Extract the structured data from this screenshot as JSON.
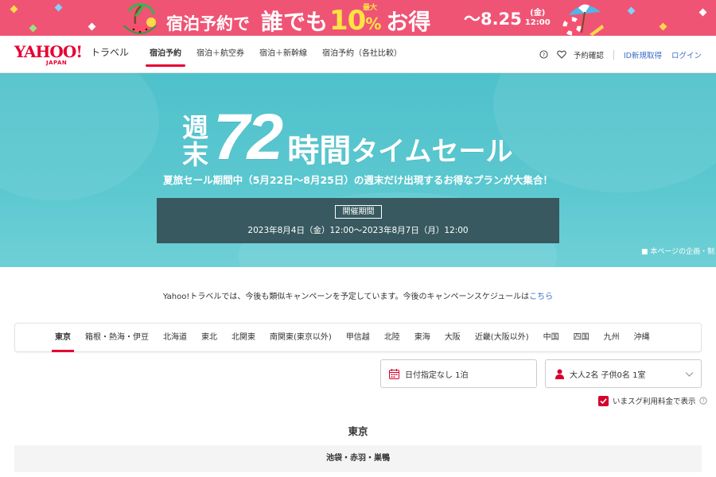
{
  "promo": {
    "text_part1": "宿泊予約で",
    "text_part2": "誰でも",
    "text_discount": "10",
    "text_percent": "%",
    "text_max": "最大",
    "text_part3": "お得",
    "date": "～8.25",
    "date_weekday": "(金)",
    "date_time": "12:00",
    "bg_color": "#ef5475",
    "accent_color": "#ffe343"
  },
  "header": {
    "logo_text": "YAHOO!",
    "logo_sub_text": "JAPAN",
    "logo_service": "トラベル",
    "nav": [
      {
        "label": "宿泊予約",
        "active": true
      },
      {
        "label": "宿泊＋航空券",
        "active": false
      },
      {
        "label": "宿泊＋新幹線",
        "active": false
      },
      {
        "label": "宿泊予約（各社比較）",
        "active": false
      }
    ],
    "help_icon": "help-circle-icon",
    "favorite_icon": "heart-icon",
    "reservation_check": "予約確認",
    "register": "ID新規取得",
    "login": "ログイン",
    "brand_color": "#e60033",
    "link_color": "#3a6cc7"
  },
  "hero": {
    "title_weekend_1": "週",
    "title_weekend_2": "末",
    "title_number": "72",
    "title_hours": "時間",
    "title_sale": "タイムセール",
    "subtitle": "夏旅セール期間中（5月22日～8月25日）の週末だけ出現するお得なプランが大集合！",
    "period_label": "開催期間",
    "period_value": "2023年8月4日（金）12:00～2023年8月7日（月）12:00",
    "note": "■ 本ページの企画・制",
    "bg_color": "#56c4cd",
    "period_bg_color": "#37595f"
  },
  "info": {
    "text": "Yahoo!トラベルでは、今後も類似キャンペーンを予定しています。今後のキャンペーンスケジュールは",
    "link": "こちら"
  },
  "regions": [
    {
      "label": "東京",
      "active": true
    },
    {
      "label": "箱根・熱海・伊豆",
      "active": false
    },
    {
      "label": "北海道",
      "active": false
    },
    {
      "label": "東北",
      "active": false
    },
    {
      "label": "北関東",
      "active": false
    },
    {
      "label": "南関東(東京以外)",
      "active": false
    },
    {
      "label": "甲信越",
      "active": false
    },
    {
      "label": "北陸",
      "active": false
    },
    {
      "label": "東海",
      "active": false
    },
    {
      "label": "大阪",
      "active": false
    },
    {
      "label": "近畿(大阪以外)",
      "active": false
    },
    {
      "label": "中国",
      "active": false
    },
    {
      "label": "四国",
      "active": false
    },
    {
      "label": "九州",
      "active": false
    },
    {
      "label": "沖縄",
      "active": false
    }
  ],
  "search": {
    "date_icon": "calendar-icon",
    "date_value": "日付指定なし 1泊",
    "guest_icon": "person-icon",
    "guest_value": "大人2名  子供0名  1室",
    "dropdown_icon": "chevron-down-icon",
    "checkbox_checked": true,
    "checkbox_label": "いまスグ利用料金で表示",
    "help_icon": "help-circle-icon"
  },
  "section": {
    "title": "東京",
    "area": "池袋・赤羽・巣鴨"
  }
}
